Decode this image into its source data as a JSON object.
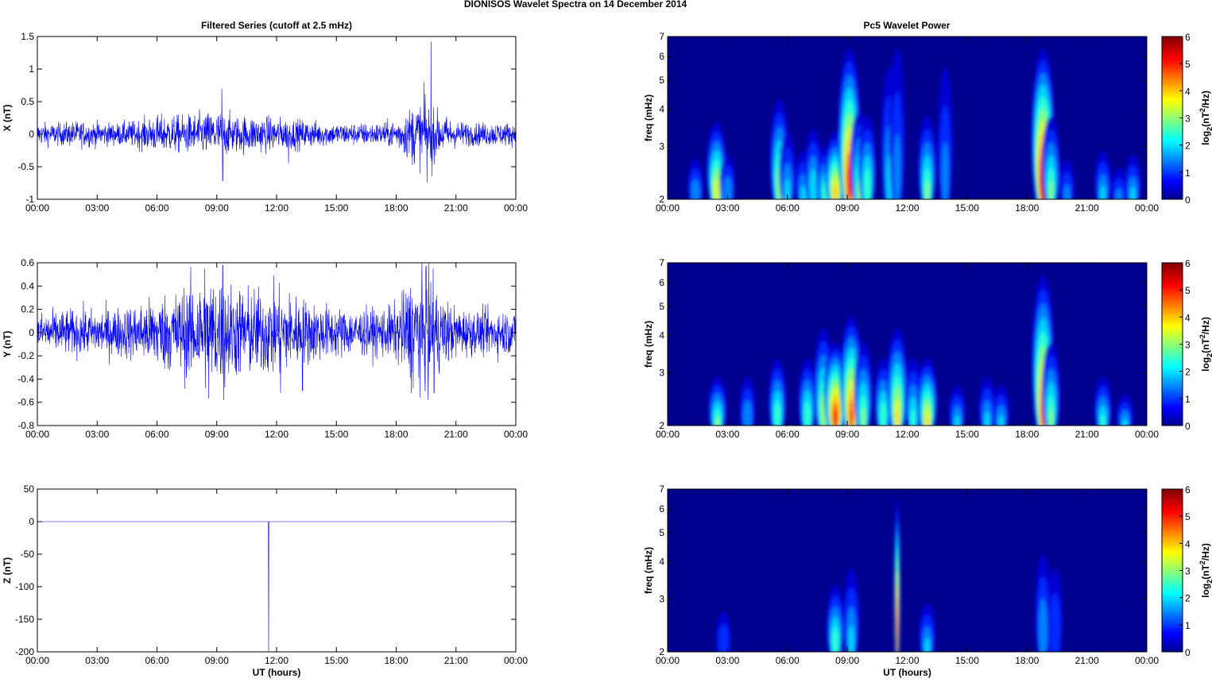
{
  "figure_title": "DIONISOS Wavelet Spectra on 14 December  2014",
  "left_column_title": "Filtered Series (cutoff at 2.5 mHz)",
  "right_column_title": "Pc5 Wavelet Power",
  "colors": {
    "series": "#0000ff",
    "heat_background": "#00008f",
    "axes": "#000000"
  },
  "chart_data": [
    {
      "type": "line",
      "id": "x-series",
      "ylabel": "X (nT)",
      "xlabel": "",
      "ylim": [
        -1,
        1.5
      ],
      "yticks": [
        "1.5",
        "1",
        "0.5",
        "0",
        "-0.5",
        "-1"
      ],
      "ytick_values": [
        1.5,
        1,
        0.5,
        0,
        -0.5,
        -1
      ],
      "xticks": [
        "00:00",
        "03:00",
        "06:00",
        "09:00",
        "12:00",
        "15:00",
        "18:00",
        "21:00",
        "00:00"
      ],
      "xlim_hours": [
        0,
        24
      ],
      "envelope_hourly": [
        0.12,
        0.12,
        0.14,
        0.13,
        0.12,
        0.15,
        0.2,
        0.2,
        0.22,
        0.25,
        0.2,
        0.2,
        0.18,
        0.16,
        0.14,
        0.12,
        0.12,
        0.12,
        0.15,
        0.35,
        0.25,
        0.14,
        0.12,
        0.13,
        0.12
      ],
      "spikes": [
        {
          "t": 9.25,
          "v": 0.7
        },
        {
          "t": 9.3,
          "v": -0.72
        },
        {
          "t": 12.6,
          "v": -0.45
        },
        {
          "t": 19.4,
          "v": 0.8
        },
        {
          "t": 19.55,
          "v": -0.75
        },
        {
          "t": 19.75,
          "v": 1.42
        },
        {
          "t": 19.8,
          "v": -0.65
        }
      ]
    },
    {
      "type": "line",
      "id": "y-series",
      "ylabel": "Y (nT)",
      "xlabel": "",
      "ylim": [
        -0.8,
        0.6
      ],
      "yticks": [
        "0.6",
        "0.4",
        "0.2",
        "0",
        "-0.2",
        "-0.4",
        "-0.6",
        "-0.8"
      ],
      "ytick_values": [
        0.6,
        0.4,
        0.2,
        0,
        -0.2,
        -0.4,
        -0.6,
        -0.8
      ],
      "xticks": [
        "00:00",
        "03:00",
        "06:00",
        "09:00",
        "12:00",
        "15:00",
        "18:00",
        "21:00",
        "00:00"
      ],
      "xlim_hours": [
        0,
        24
      ],
      "envelope_hourly": [
        0.12,
        0.13,
        0.14,
        0.14,
        0.15,
        0.17,
        0.22,
        0.25,
        0.32,
        0.33,
        0.28,
        0.26,
        0.27,
        0.22,
        0.18,
        0.15,
        0.14,
        0.14,
        0.17,
        0.38,
        0.25,
        0.15,
        0.13,
        0.14,
        0.13
      ],
      "spikes": [
        {
          "t": 8.4,
          "v": 0.55
        },
        {
          "t": 8.6,
          "v": -0.57
        },
        {
          "t": 9.3,
          "v": 0.58
        },
        {
          "t": 9.35,
          "v": -0.58
        },
        {
          "t": 12.2,
          "v": -0.52
        },
        {
          "t": 13.3,
          "v": -0.5
        },
        {
          "t": 19.5,
          "v": 0.57
        },
        {
          "t": 19.6,
          "v": -0.58
        },
        {
          "t": 19.85,
          "v": 0.55
        },
        {
          "t": 19.9,
          "v": -0.52
        }
      ]
    },
    {
      "type": "line",
      "id": "z-series",
      "ylabel": "Z (nT)",
      "xlabel": "UT (hours)",
      "ylim": [
        -200,
        50
      ],
      "yticks": [
        "50",
        "0",
        "-50",
        "-100",
        "-150",
        "-200"
      ],
      "ytick_values": [
        50,
        0,
        -50,
        -100,
        -150,
        -200
      ],
      "xticks": [
        "00:00",
        "03:00",
        "06:00",
        "09:00",
        "12:00",
        "15:00",
        "18:00",
        "21:00",
        "00:00"
      ],
      "xlim_hours": [
        0,
        24
      ],
      "envelope_hourly": [
        0.3,
        0.3,
        0.3,
        0.3,
        0.3,
        0.3,
        0.3,
        0.3,
        0.3,
        0.3,
        0.3,
        0.3,
        0.3,
        0.3,
        0.3,
        0.3,
        0.3,
        0.3,
        0.3,
        0.3,
        0.3,
        0.3,
        0.3,
        0.3,
        0.3
      ],
      "spikes": [
        {
          "t": 11.6,
          "v": -200
        }
      ]
    },
    {
      "type": "heatmap",
      "id": "x-wavelet",
      "ylabel": "freq (mHz)",
      "xlabel": "",
      "ylim_mHz": [
        2,
        7
      ],
      "yscale": "log",
      "yticks": [
        "7",
        "6",
        "5",
        "4",
        "3",
        "2"
      ],
      "ytick_values": [
        7,
        6,
        5,
        4,
        3,
        2
      ],
      "xticks": [
        "00:00",
        "03:00",
        "06:00",
        "09:00",
        "12:00",
        "15:00",
        "18:00",
        "21:00",
        "00:00"
      ],
      "xlim_hours": [
        0,
        24
      ],
      "colorbar": {
        "label": "log2(nT2/Hz)",
        "ticks": [
          "6",
          "5",
          "4",
          "3",
          "2",
          "1",
          "0"
        ],
        "range": [
          0,
          6
        ]
      },
      "blobs": [
        {
          "t": 1.4,
          "top": 2.8,
          "p": 1.6
        },
        {
          "t": 2.45,
          "top": 3.8,
          "p": 3.6
        },
        {
          "t": 3.0,
          "top": 2.9,
          "p": 1.6
        },
        {
          "t": 5.6,
          "top": 4.6,
          "p": 3.2
        },
        {
          "t": 6.0,
          "top": 3.5,
          "p": 2
        },
        {
          "t": 6.8,
          "top": 3.0,
          "p": 2
        },
        {
          "t": 7.3,
          "top": 3.6,
          "p": 2.2
        },
        {
          "t": 7.9,
          "top": 3.1,
          "p": 2.6
        },
        {
          "t": 8.4,
          "top": 3.5,
          "p": 4.2
        },
        {
          "t": 9.1,
          "top": 7,
          "p": 5.2
        },
        {
          "t": 9.6,
          "top": 4.2,
          "p": 3
        },
        {
          "t": 10.0,
          "top": 4,
          "p": 2.6
        },
        {
          "t": 11.1,
          "top": 6,
          "p": 2
        },
        {
          "t": 11.5,
          "top": 7,
          "p": 1.5
        },
        {
          "t": 13.0,
          "top": 4,
          "p": 3
        },
        {
          "t": 13.9,
          "top": 6,
          "p": 1.5
        },
        {
          "t": 18.8,
          "top": 7,
          "p": 5.6
        },
        {
          "t": 19.2,
          "top": 4,
          "p": 3
        },
        {
          "t": 20.0,
          "top": 2.8,
          "p": 1.5
        },
        {
          "t": 21.8,
          "top": 3,
          "p": 2
        },
        {
          "t": 22.6,
          "top": 2.6,
          "p": 1.5
        },
        {
          "t": 23.3,
          "top": 2.9,
          "p": 2
        }
      ]
    },
    {
      "type": "heatmap",
      "id": "y-wavelet",
      "ylabel": "freq (mHz)",
      "xlabel": "",
      "ylim_mHz": [
        2,
        7
      ],
      "yscale": "log",
      "yticks": [
        "7",
        "6",
        "5",
        "4",
        "3",
        "2"
      ],
      "ytick_values": [
        7,
        6,
        5,
        4,
        3,
        2
      ],
      "xticks": [
        "00:00",
        "03:00",
        "06:00",
        "09:00",
        "12:00",
        "15:00",
        "18:00",
        "21:00",
        "00:00"
      ],
      "xlim_hours": [
        0,
        24
      ],
      "colorbar": {
        "label": "log2(nT2/Hz)",
        "ticks": [
          "6",
          "5",
          "4",
          "3",
          "2",
          "1",
          "0"
        ],
        "range": [
          0,
          6
        ]
      },
      "blobs": [
        {
          "t": 2.5,
          "top": 3,
          "p": 3
        },
        {
          "t": 4.0,
          "top": 3,
          "p": 1.6
        },
        {
          "t": 5.5,
          "top": 3.5,
          "p": 2.6
        },
        {
          "t": 7.0,
          "top": 3.5,
          "p": 2.6
        },
        {
          "t": 7.8,
          "top": 4.5,
          "p": 3.2
        },
        {
          "t": 8.4,
          "top": 4,
          "p": 5.2
        },
        {
          "t": 9.2,
          "top": 5,
          "p": 5
        },
        {
          "t": 9.8,
          "top": 4,
          "p": 3
        },
        {
          "t": 10.8,
          "top": 3.5,
          "p": 2.6
        },
        {
          "t": 11.5,
          "top": 4.5,
          "p": 4
        },
        {
          "t": 12.3,
          "top": 3.5,
          "p": 2.5
        },
        {
          "t": 13.0,
          "top": 3.5,
          "p": 4
        },
        {
          "t": 14.5,
          "top": 2.8,
          "p": 2
        },
        {
          "t": 16.0,
          "top": 3,
          "p": 2
        },
        {
          "t": 16.7,
          "top": 2.8,
          "p": 2
        },
        {
          "t": 18.8,
          "top": 7,
          "p": 5
        },
        {
          "t": 19.2,
          "top": 4,
          "p": 3
        },
        {
          "t": 21.8,
          "top": 3,
          "p": 2.5
        },
        {
          "t": 22.9,
          "top": 2.6,
          "p": 2
        }
      ]
    },
    {
      "type": "heatmap",
      "id": "z-wavelet",
      "ylabel": "freq (mHz)",
      "xlabel": "UT (hours)",
      "ylim_mHz": [
        2,
        7
      ],
      "yscale": "log",
      "yticks": [
        "7",
        "6",
        "5",
        "4",
        "3",
        "2"
      ],
      "ytick_values": [
        7,
        6,
        5,
        4,
        3,
        2
      ],
      "xticks": [
        "00:00",
        "03:00",
        "06:00",
        "09:00",
        "12:00",
        "15:00",
        "18:00",
        "21:00",
        "00:00"
      ],
      "xlim_hours": [
        0,
        24
      ],
      "colorbar": {
        "label": "log2(nT2/Hz)",
        "ticks": [
          "6",
          "5",
          "4",
          "3",
          "2",
          "1",
          "0"
        ],
        "range": [
          0,
          6
        ]
      },
      "blobs": [
        {
          "t": 2.8,
          "top": 2.8,
          "p": 1.2
        },
        {
          "t": 8.4,
          "top": 3.5,
          "p": 2.6
        },
        {
          "t": 9.2,
          "top": 4,
          "p": 2
        },
        {
          "t": 11.5,
          "top": 7.2,
          "p": 6,
          "narrow": true
        },
        {
          "t": 13.0,
          "top": 3,
          "p": 2
        },
        {
          "t": 18.8,
          "top": 4.5,
          "p": 1.6
        },
        {
          "t": 19.4,
          "top": 4,
          "p": 1.3
        }
      ]
    }
  ]
}
